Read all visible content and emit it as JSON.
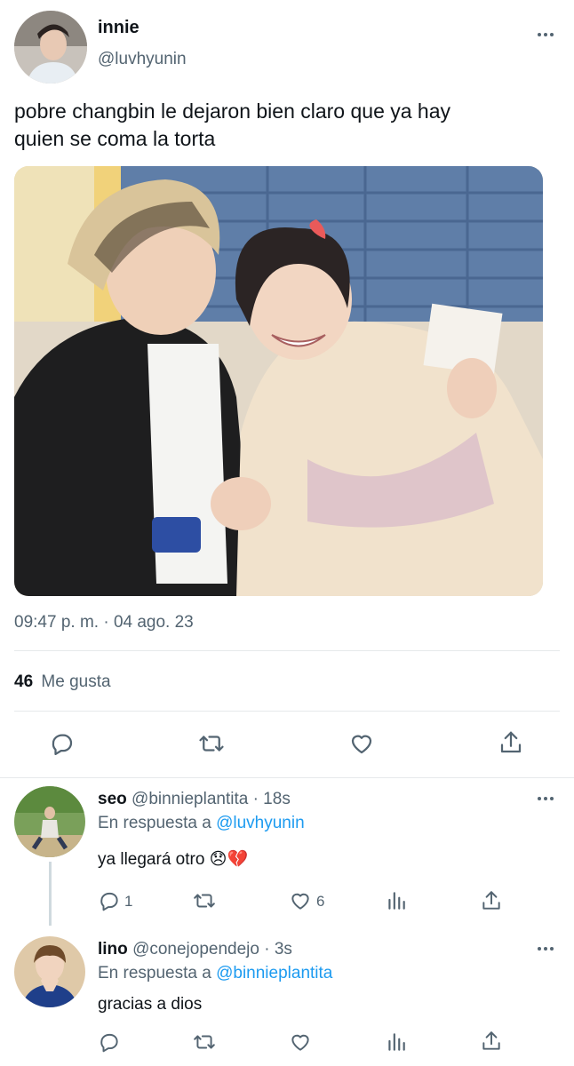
{
  "tweet": {
    "display_name": "innie",
    "handle": "@luvhyunin",
    "text_line1": "pobre changbin le dejaron bien claro que ya hay",
    "text_line2": "quien se coma la torta",
    "timestamp": "09:47 p. m. · 04 ago. 23",
    "likes_count": "46",
    "likes_label": "Me gusta"
  },
  "replies": [
    {
      "display_name": "seo",
      "handle": "@binnieplantita",
      "time": "· 18s",
      "reply_prefix": "En respuesta a",
      "reply_to": "@luvhyunin",
      "text": "ya llegará otro 😞💔",
      "reply_count": "1",
      "like_count": "6"
    },
    {
      "display_name": "lino",
      "handle": "@conejopendejo",
      "time": "· 3s",
      "reply_prefix": "En respuesta a",
      "reply_to": "@binnieplantita",
      "text": "gracias a dios"
    }
  ],
  "colors": {
    "accent": "#1d9bf0",
    "muted": "#536471",
    "divider": "#e6e9eb"
  },
  "icons": [
    "more-icon",
    "reply-icon",
    "retweet-icon",
    "like-icon",
    "share-icon",
    "analytics-icon"
  ]
}
